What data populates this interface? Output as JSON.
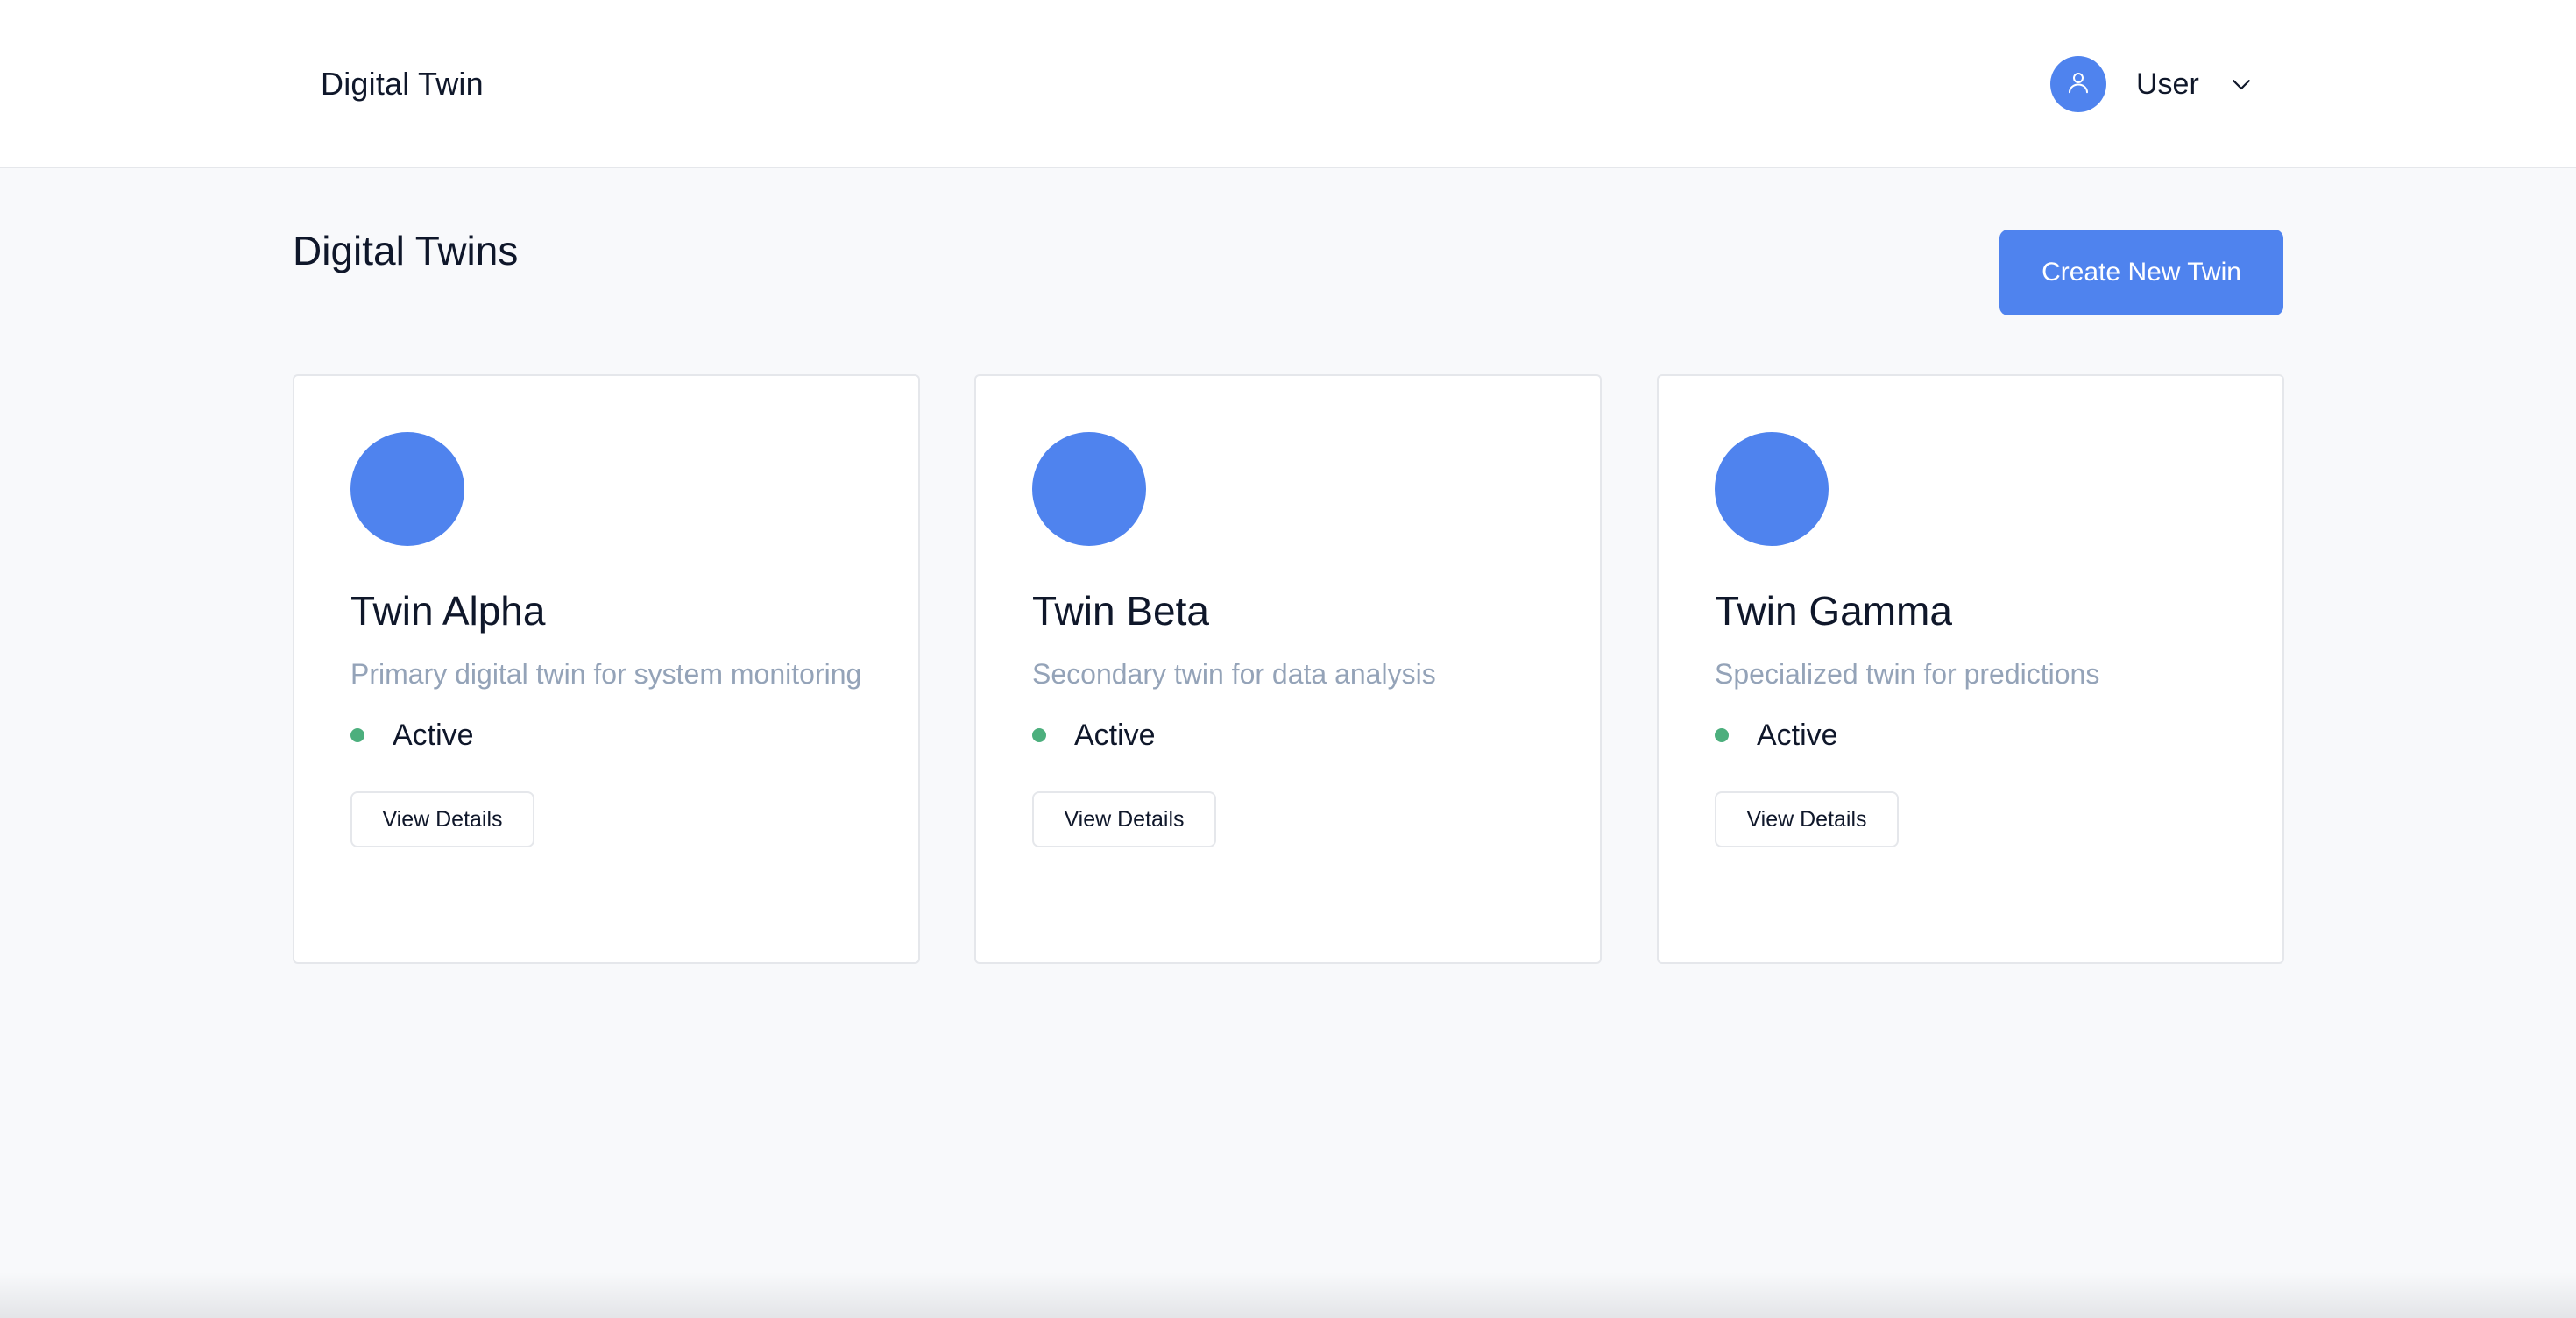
{
  "header": {
    "brand": "Digital Twin",
    "user": {
      "name": "User",
      "avatar_icon": "user-icon",
      "menu_icon": "chevron-down-icon"
    }
  },
  "main": {
    "title": "Digital Twins",
    "create_button_label": "Create New Twin",
    "cards": [
      {
        "title": "Twin Alpha",
        "description": "Primary digital twin for system monitoring",
        "status": "Active",
        "button_label": "View Details"
      },
      {
        "title": "Twin Beta",
        "description": "Secondary twin for data analysis",
        "status": "Active",
        "button_label": "View Details"
      },
      {
        "title": "Twin Gamma",
        "description": "Specialized twin for predictions",
        "status": "Active",
        "button_label": "View Details"
      }
    ]
  },
  "colors": {
    "accent": "#4f83ee",
    "status_active": "#4caf7d",
    "muted_text": "#94a3b8",
    "text": "#0f172a",
    "background": "#f8f9fb",
    "border": "#e5e7eb"
  }
}
